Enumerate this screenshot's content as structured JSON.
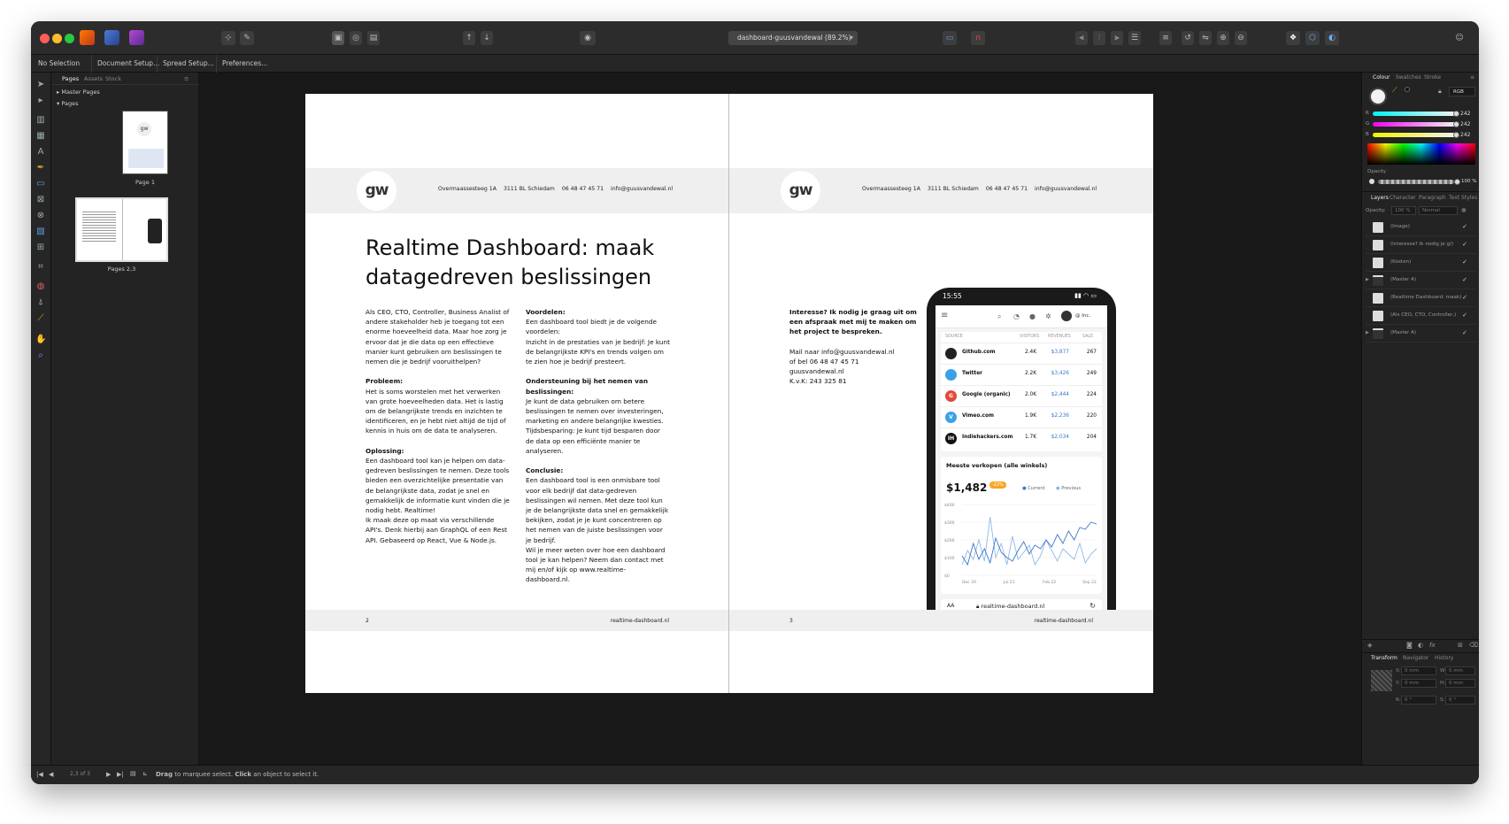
{
  "window": {
    "document_title": "dashboard-guusvandewal (89.2%)"
  },
  "context_toolbar": {
    "selection": "No Selection",
    "document_setup": "Document Setup...",
    "spread_setup": "Spread Setup...",
    "preferences": "Preferences..."
  },
  "pages_panel": {
    "tabs": [
      "Pages",
      "Assets",
      "Stock"
    ],
    "master_pages": "Master Pages",
    "pages": "Pages",
    "page1_label": "Page 1",
    "pages23_label": "Pages 2,3"
  },
  "document": {
    "logo": "gw",
    "address": [
      "Overmaassesteeg 1A",
      "3111 BL Schiedam",
      "06 48 47 45 71",
      "info@guusvandewal.nl"
    ],
    "footer_url": "realtime-dashboard.nl",
    "left_page_number": "2",
    "right_page_number": "3",
    "title": "Realtime Dashboard: maak datagedreven beslissingen",
    "col1": {
      "intro": "Als CEO, CTO, Controller, Business Analist of andere stakeholder heb je toegang tot een enorme hoeveelheid data. Maar hoe zorg je ervoor dat je die data op een effectieve manier kunt gebruiken om beslissingen te nemen die je bedrijf vooruithelpen?",
      "probleem_head": "Probleem:",
      "probleem": "Het is soms worstelen met het verwerken van grote hoeveelheden data. Het is lastig om de belangrijkste trends en inzichten te identificeren, en je hebt niet altijd de tijd of kennis in huis om de data te analyseren.",
      "oplossing_head": "Oplossing:",
      "oplossing": "Een dashboard tool kan je helpen om data-gedreven beslissingen te nemen. Deze tools bieden een overzichtelijke presentatie van de belangrijkste data, zodat je snel en gemakkelijk de informatie kunt vinden die je nodig hebt. Realtime!",
      "oplossing2": "Ik maak deze op maat via verschillende API's. Denk hierbij aan GraphQL of een Rest API. Gebaseerd op React, Vue & Node.js."
    },
    "col2": {
      "voordelen_head": "Voordelen:",
      "voordelen": "Een dashboard tool biedt je de volgende voordelen:",
      "voordelen2": "Inzicht in de prestaties van je bedrijf: Je kunt de belangrijkste KPI's en trends volgen om te zien hoe je bedrijf presteert.",
      "ondersteuning_head": "Ondersteuning bij het nemen van beslissingen:",
      "ondersteuning": "Je kunt de data gebruiken om betere beslissingen te nemen over investeringen, marketing en andere belangrijke kwesties.",
      "tijd": "Tijdsbesparing: Je kunt tijd besparen door de data op een efficiënte manier te analyseren.",
      "conclusie_head": "Conclusie:",
      "conclusie": "Een dashboard tool is een onmisbare tool voor elk bedrijf dat data-gedreven beslissingen wil nemen. Met deze tool kun je de belangrijkste data snel en gemakkelijk bekijken, zodat je je kunt concentreren op het nemen van de juiste beslissingen voor je bedrijf.",
      "conclusie2": "Wil je meer weten over hoe een dashboard tool je kan helpen? Neem dan contact met mij en/of kijk op www.realtime-dashboard.nl."
    },
    "right": {
      "cta": "Interesse? Ik nodig je graag uit om een afspraak met mij te maken om het project te bespreken.",
      "mail": "Mail naar info@guusvandewal.nl",
      "phone": "of bel 06 48 47 45 71",
      "site": "guusvandewal.nl",
      "kvk": "K.v.K: 243 325 81"
    }
  },
  "phone": {
    "time": "15:55",
    "org": "@ Inc.",
    "table_headers": [
      "SOURCE",
      "VISITORS",
      "REVENUES",
      "SALE"
    ],
    "rows": [
      {
        "icon": "github-icon",
        "color": "#222222",
        "initial": "",
        "name": "Github.com",
        "visitors": "2.4K",
        "revenue": "$3,877",
        "sales": "267"
      },
      {
        "icon": "twitter-icon",
        "color": "#3aa0e8",
        "initial": "",
        "name": "Twitter",
        "visitors": "2.2K",
        "revenue": "$3,426",
        "sales": "249"
      },
      {
        "icon": "google-icon",
        "color": "#e24a3b",
        "initial": "G",
        "name": "Google (organic)",
        "visitors": "2.0K",
        "revenue": "$2,444",
        "sales": "224"
      },
      {
        "icon": "vimeo-icon",
        "color": "#3aa0e8",
        "initial": "V",
        "name": "Vimeo.com",
        "visitors": "1.9K",
        "revenue": "$2,236",
        "sales": "220"
      },
      {
        "icon": "indiehackers-icon",
        "color": "#111111",
        "initial": "IH",
        "name": "Indiehackers.com",
        "visitors": "1.7K",
        "revenue": "$2,034",
        "sales": "204"
      }
    ],
    "sales_title": "Meeste verkopen (alle winkels)",
    "sales_value": "$1,482",
    "sales_badge": "-22%",
    "legend_current": "Current",
    "legend_previous": "Previous",
    "url": "realtime-dashboard.nl",
    "aa": "AA"
  },
  "chart_data": {
    "type": "line",
    "title": "Meeste verkopen (alle winkels)",
    "x_labels": [
      "Dec 20",
      "Jul 21",
      "Feb 22",
      "Sep 22"
    ],
    "y_ticks": [
      "$400",
      "$300",
      "$200",
      "$100",
      "$0"
    ],
    "ylim": [
      0,
      400
    ],
    "series": [
      {
        "name": "Current",
        "color": "#3a78c8",
        "values": [
          110,
          60,
          180,
          90,
          150,
          70,
          210,
          130,
          100,
          80,
          140,
          190,
          120,
          170,
          150,
          200,
          160,
          230,
          180,
          250,
          200,
          270,
          260,
          300,
          290
        ]
      },
      {
        "name": "Previous",
        "color": "#8fb8e6",
        "values": [
          60,
          140,
          90,
          200,
          80,
          330,
          100,
          180,
          60,
          220,
          90,
          130,
          170,
          60,
          110,
          200,
          140,
          80,
          150,
          120,
          90,
          180,
          70,
          120,
          150
        ]
      }
    ]
  },
  "colour_panel": {
    "tabs": [
      "Colour",
      "Swatches",
      "Stroke"
    ],
    "model": "RGB",
    "r": "242",
    "g": "242",
    "b": "242",
    "r_label": "R",
    "g_label": "G",
    "b_label": "B",
    "opacity_label": "Opacity",
    "opacity": "100 %"
  },
  "layers_panel": {
    "tabs": [
      "Layers",
      "Character",
      "Paragraph",
      "Text Styles"
    ],
    "opacity_label": "Opacity:",
    "opacity_value": "100 %",
    "blend": "Normal",
    "layers": [
      "(Image)",
      "(Interesse? Ik nodig je g/)",
      "(Kosten)",
      "(Master A)",
      "(Realtime Dashboard: maak)",
      "(Als CEO, CTO, Controller,)",
      "(Master A)"
    ]
  },
  "transform_panel": {
    "tabs": [
      "Transform",
      "Navigator",
      "History"
    ],
    "x": "0 mm",
    "y": "0 mm",
    "w": "0 mm",
    "h": "0 mm",
    "r": "0 °",
    "s": "0 °",
    "x_label": "X:",
    "y_label": "Y:",
    "w_label": "W:",
    "h_label": "H:",
    "r_label": "R:",
    "s_label": "S:"
  },
  "statusbar": {
    "page": "2,3 of 3",
    "hint_drag": "Drag",
    "hint_mid": " to marquee select. ",
    "hint_click": "Click",
    "hint_end": " an object to select it."
  }
}
